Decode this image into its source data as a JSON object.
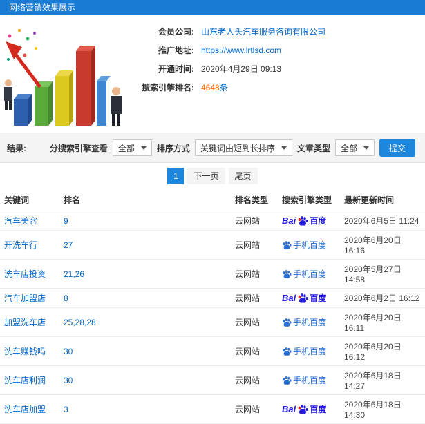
{
  "header": {
    "title": "网络营销效果展示"
  },
  "info": {
    "rows": [
      {
        "label": "会员公司:",
        "value": "山东老人头汽车服务咨询有限公司"
      },
      {
        "label": "推广地址:",
        "value": "https://www.lrtlsd.com"
      },
      {
        "label": "开通时间:",
        "value": "2020年4月29日 09:13"
      },
      {
        "label": "搜索引擎排名:",
        "number": "4648",
        "unit": "条"
      }
    ]
  },
  "filters": {
    "section_label": "结果:",
    "engine_label": "分搜索引擎查看",
    "engine_value": "全部",
    "sort_label": "排序方式",
    "sort_value": "关键词由短到长排序",
    "type_label": "文章类型",
    "type_value": "全部",
    "submit_label": "提交"
  },
  "pagination": {
    "current": "1",
    "next_label": "下一页",
    "last_label": "尾页"
  },
  "table": {
    "headers": [
      "关键词",
      "排名",
      "排名类型",
      "搜索引擎类型",
      "最新更新时间"
    ],
    "engine_labels": {
      "baidu_prefix": "Bai",
      "baidu_suffix": "百度",
      "mobile": "手机百度"
    },
    "rows": [
      {
        "keyword": "汽车美容",
        "rank": "9",
        "rank_type": "云网站",
        "engine": "baidu",
        "time": "2020年6月5日 11:24"
      },
      {
        "keyword": "开洗车行",
        "rank": "27",
        "rank_type": "云网站",
        "engine": "mobile",
        "time": "2020年6月20日 16:16"
      },
      {
        "keyword": "洗车店投资",
        "rank": "21,26",
        "rank_type": "云网站",
        "engine": "mobile",
        "time": "2020年5月27日 14:58"
      },
      {
        "keyword": "汽车加盟店",
        "rank": "8",
        "rank_type": "云网站",
        "engine": "baidu",
        "time": "2020年6月2日 16:12"
      },
      {
        "keyword": "加盟洗车店",
        "rank": "25,28,28",
        "rank_type": "云网站",
        "engine": "mobile",
        "time": "2020年6月20日 16:11"
      },
      {
        "keyword": "洗车赚钱吗",
        "rank": "30",
        "rank_type": "云网站",
        "engine": "mobile",
        "time": "2020年6月20日 16:12"
      },
      {
        "keyword": "洗车店利润",
        "rank": "30",
        "rank_type": "云网站",
        "engine": "mobile",
        "time": "2020年6月18日 14:27"
      },
      {
        "keyword": "洗车店加盟",
        "rank": "3",
        "rank_type": "云网站",
        "engine": "baidu",
        "time": "2020年6月18日 14:30"
      }
    ]
  },
  "colors": {
    "accent_blue": "#1d86dd",
    "header_blue": "#1a7bd4",
    "link_blue": "#0066cc",
    "count_orange": "#ff6600",
    "baidu_blue": "#2319dc",
    "baidu_red": "#d9261c"
  }
}
